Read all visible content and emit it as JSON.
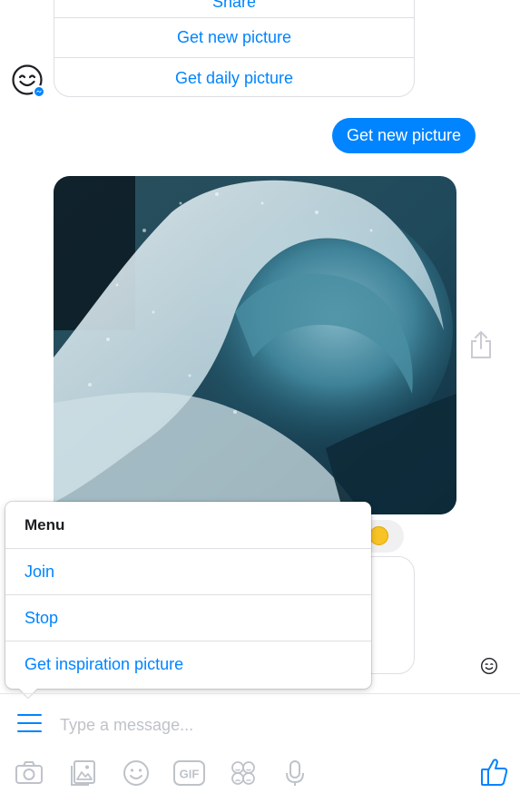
{
  "quick_replies": {
    "items": [
      {
        "label": "Share"
      },
      {
        "label": "Get new picture"
      },
      {
        "label": "Get daily picture"
      }
    ]
  },
  "user_message": {
    "text": "Get new picture"
  },
  "menu": {
    "title": "Menu",
    "items": [
      {
        "label": "Join"
      },
      {
        "label": "Stop"
      },
      {
        "label": "Get inspiration picture"
      }
    ]
  },
  "composer": {
    "placeholder": "Type a message..."
  },
  "toolbar": {
    "icons": [
      "camera-icon",
      "gallery-icon",
      "emoji-icon",
      "gif-icon",
      "stickers-icon",
      "microphone-icon",
      "thumbs-up-icon"
    ]
  },
  "colors": {
    "accent": "#0084ff",
    "bubble_user": "#0084ff",
    "toolbar_icon": "#bec3c9",
    "border": "#dddfe2"
  }
}
